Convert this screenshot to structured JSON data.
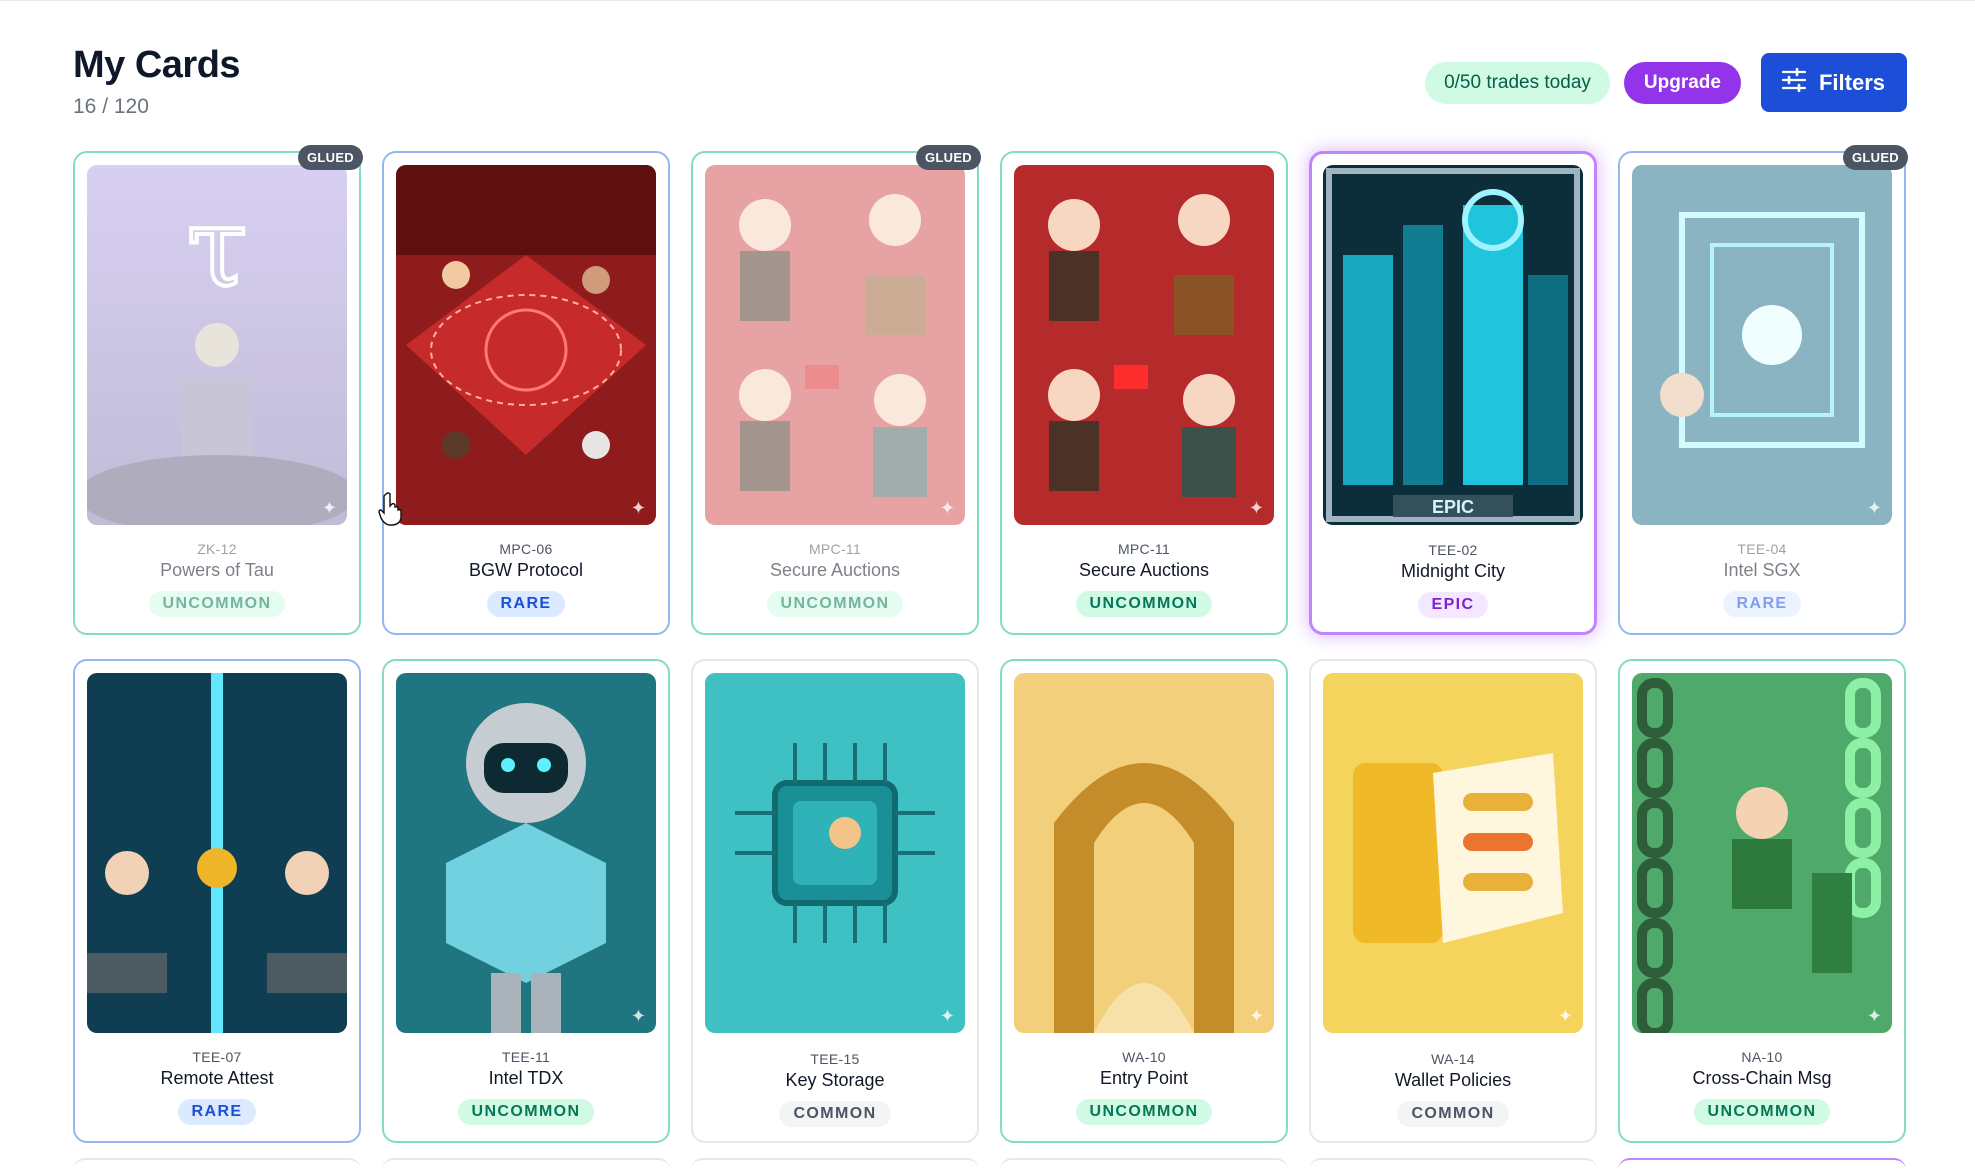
{
  "page": {
    "title": "My Cards",
    "count": "16 / 120"
  },
  "toolbar": {
    "trades": "0/50 trades today",
    "upgrade": "Upgrade",
    "filters": "Filters"
  },
  "glued_label": "GLUED",
  "colors": {
    "uncommon": "#047857",
    "rare": "#1d4ed8",
    "common": "#4b5563",
    "epic": "#7e22ce",
    "filters_button": "#1d4ed8",
    "upgrade_button": "#9333ea"
  },
  "cards": [
    {
      "code": "ZK-12",
      "name": "Powers of Tau",
      "rarity": "UNCOMMON",
      "glued": true
    },
    {
      "code": "MPC-06",
      "name": "BGW Protocol",
      "rarity": "RARE",
      "glued": false
    },
    {
      "code": "MPC-11",
      "name": "Secure Auctions",
      "rarity": "UNCOMMON",
      "glued": true
    },
    {
      "code": "MPC-11",
      "name": "Secure Auctions",
      "rarity": "UNCOMMON",
      "glued": false
    },
    {
      "code": "TEE-02",
      "name": "Midnight City",
      "rarity": "EPIC",
      "glued": false,
      "art_label": "EPIC"
    },
    {
      "code": "TEE-04",
      "name": "Intel SGX",
      "rarity": "RARE",
      "glued": true
    },
    {
      "code": "TEE-07",
      "name": "Remote Attest",
      "rarity": "RARE",
      "glued": false
    },
    {
      "code": "TEE-11",
      "name": "Intel TDX",
      "rarity": "UNCOMMON",
      "glued": false
    },
    {
      "code": "TEE-15",
      "name": "Key Storage",
      "rarity": "COMMON",
      "glued": false
    },
    {
      "code": "WA-10",
      "name": "Entry Point",
      "rarity": "UNCOMMON",
      "glued": false
    },
    {
      "code": "WA-14",
      "name": "Wallet Policies",
      "rarity": "COMMON",
      "glued": false
    },
    {
      "code": "NA-10",
      "name": "Cross-Chain Msg",
      "rarity": "UNCOMMON",
      "glued": false
    }
  ]
}
